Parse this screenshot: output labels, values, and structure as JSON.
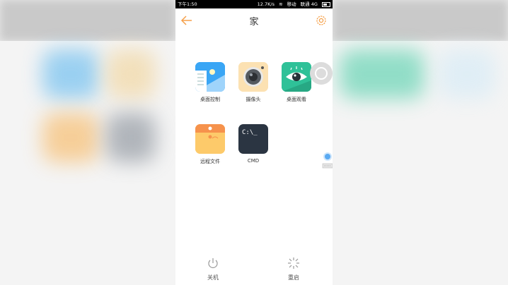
{
  "status_bar": {
    "time": "下午1:50",
    "speed": "12.7K/s",
    "carrier": "移动",
    "carrier2": "联通 4G"
  },
  "header": {
    "title": "家",
    "accent_color": "#f5a04a"
  },
  "apps": [
    {
      "label": "桌面控制",
      "icon": "desktop-control-icon"
    },
    {
      "label": "摄像头",
      "icon": "camera-icon"
    },
    {
      "label": "桌面观看",
      "icon": "eye-icon"
    },
    {
      "label": "远程文件",
      "icon": "folder-icon"
    },
    {
      "label": "CMD",
      "icon": "cmd-icon",
      "icon_text": "C:\\_"
    }
  ],
  "bottom": {
    "shutdown_label": "关机",
    "restart_label": "重启"
  }
}
